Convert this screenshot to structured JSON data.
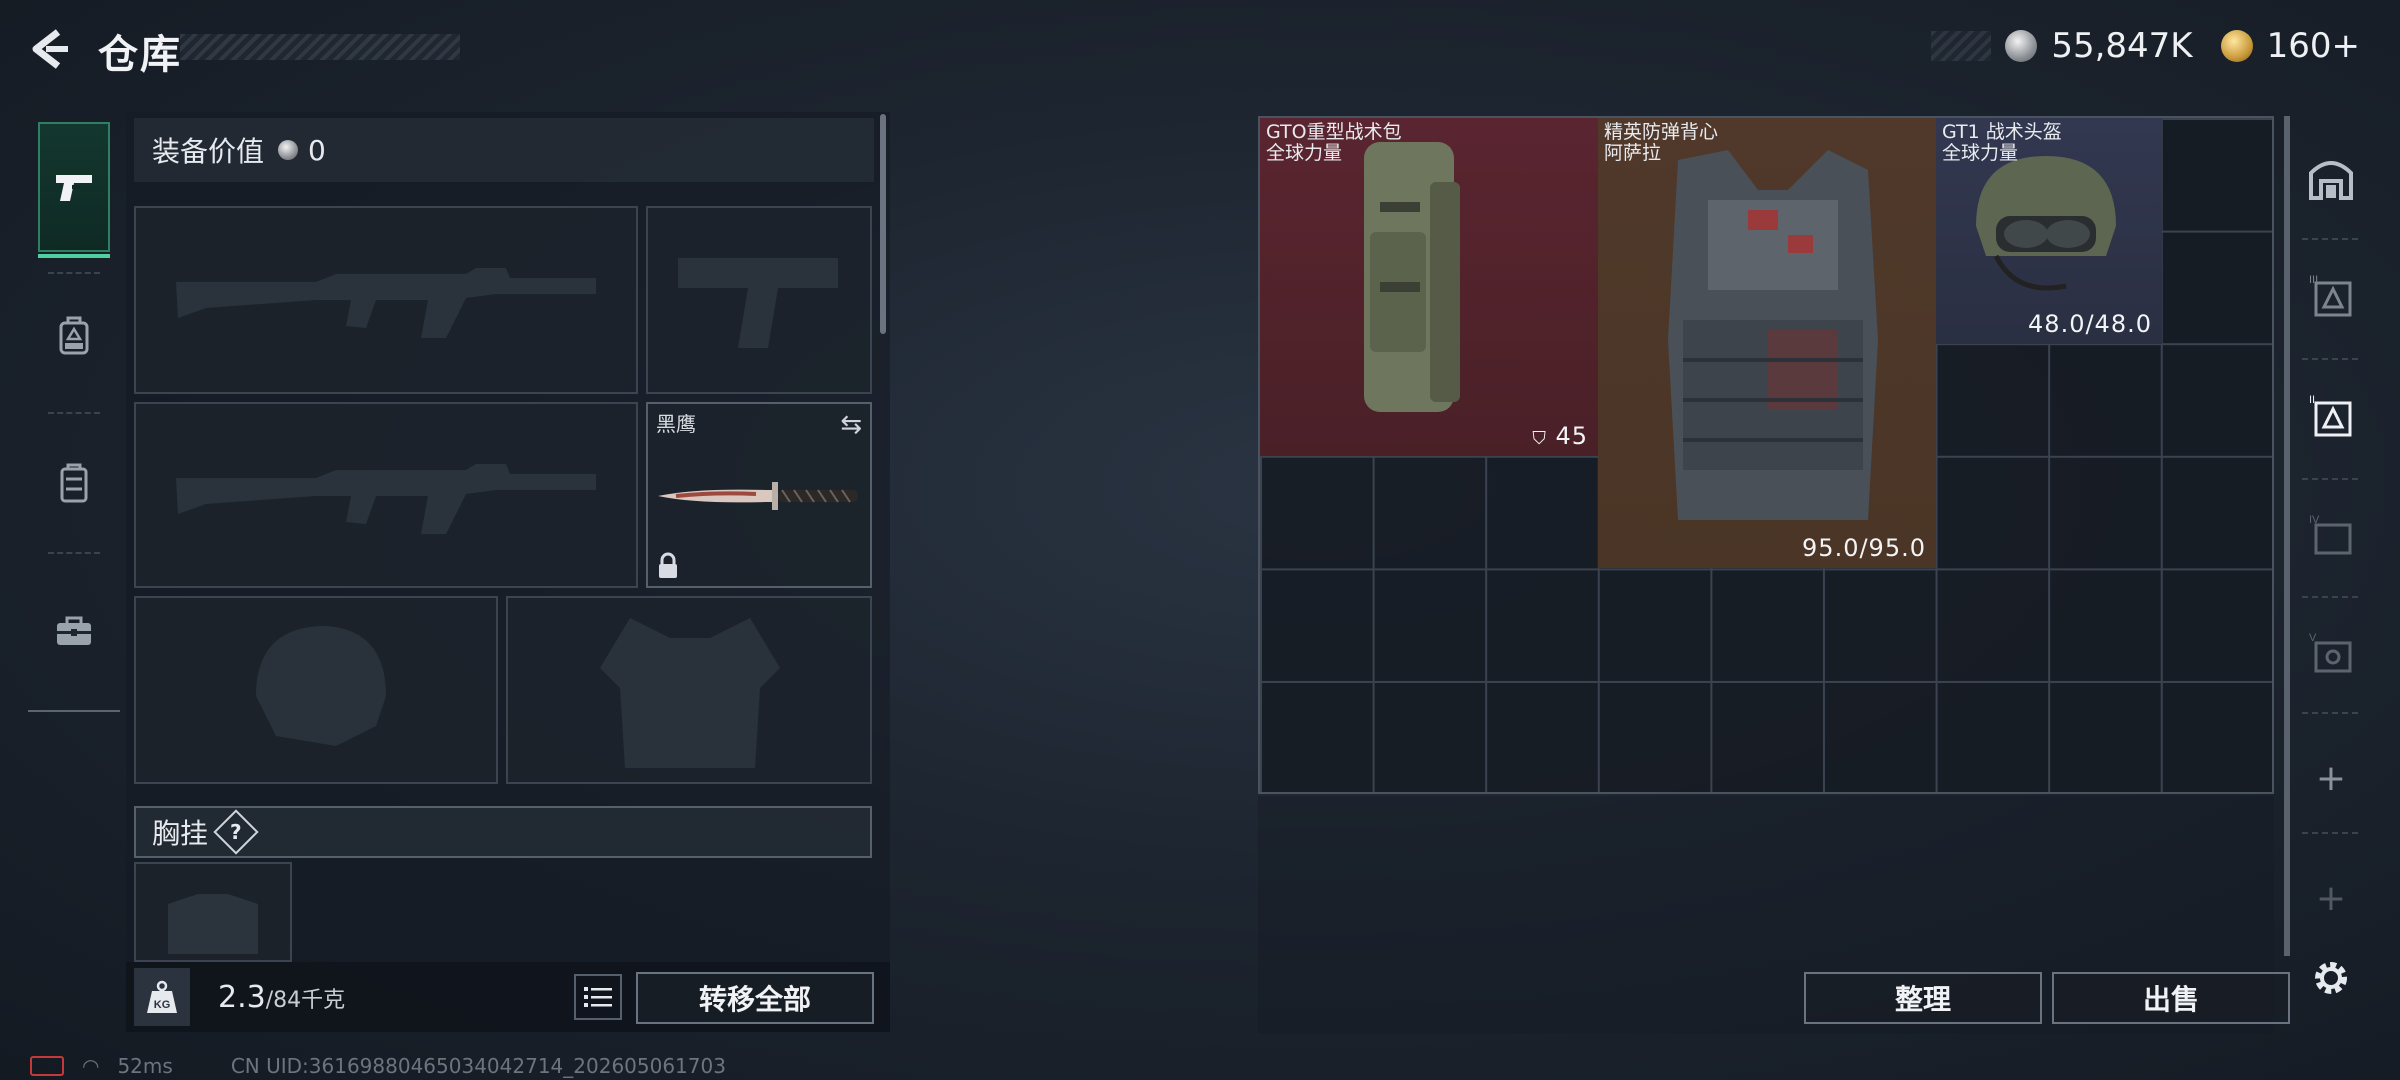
{
  "header": {
    "title": "仓库",
    "silver_amount": "55,847K",
    "gold_amount": "160+"
  },
  "left_categories": [
    {
      "icon": "pistol-icon",
      "active": true
    },
    {
      "icon": "backpack-icon",
      "active": false
    },
    {
      "icon": "locker-icon",
      "active": false
    },
    {
      "icon": "toolbox-icon",
      "active": false
    }
  ],
  "equipment": {
    "value_label": "装备价值",
    "value": "0",
    "melee_name": "黑鹰",
    "chest_label": "胸挂",
    "help_symbol": "?"
  },
  "weight": {
    "current": "2.3",
    "max": "/84千克",
    "transfer_all": "转移全部"
  },
  "stash_items": [
    {
      "name_line1": "GTO重型战术包",
      "name_line2": "全球力量",
      "value": "45"
    },
    {
      "name_line1": "精英防弹背心",
      "name_line2": "阿萨拉",
      "value": "95.0/95.0"
    },
    {
      "name_line1": "GT1 战术头盔",
      "name_line2": "全球力量",
      "value": "48.0/48.0"
    }
  ],
  "actions": {
    "sort": "整理",
    "sell": "出售"
  },
  "right_categories": [
    "home-icon",
    "tier-3-icon",
    "tier-2-icon",
    "tier-4-icon",
    "tier-5-icon",
    "add-icon",
    "add-icon"
  ],
  "status": {
    "ping": "52ms",
    "uid": "CN UID:36169880465034042714_202605061703"
  },
  "colors": {
    "accent_green": "#4fd0a0",
    "bag_bg": "#4a2027",
    "vest_bg": "#4a3526",
    "helmet_bg": "#2e3346"
  }
}
